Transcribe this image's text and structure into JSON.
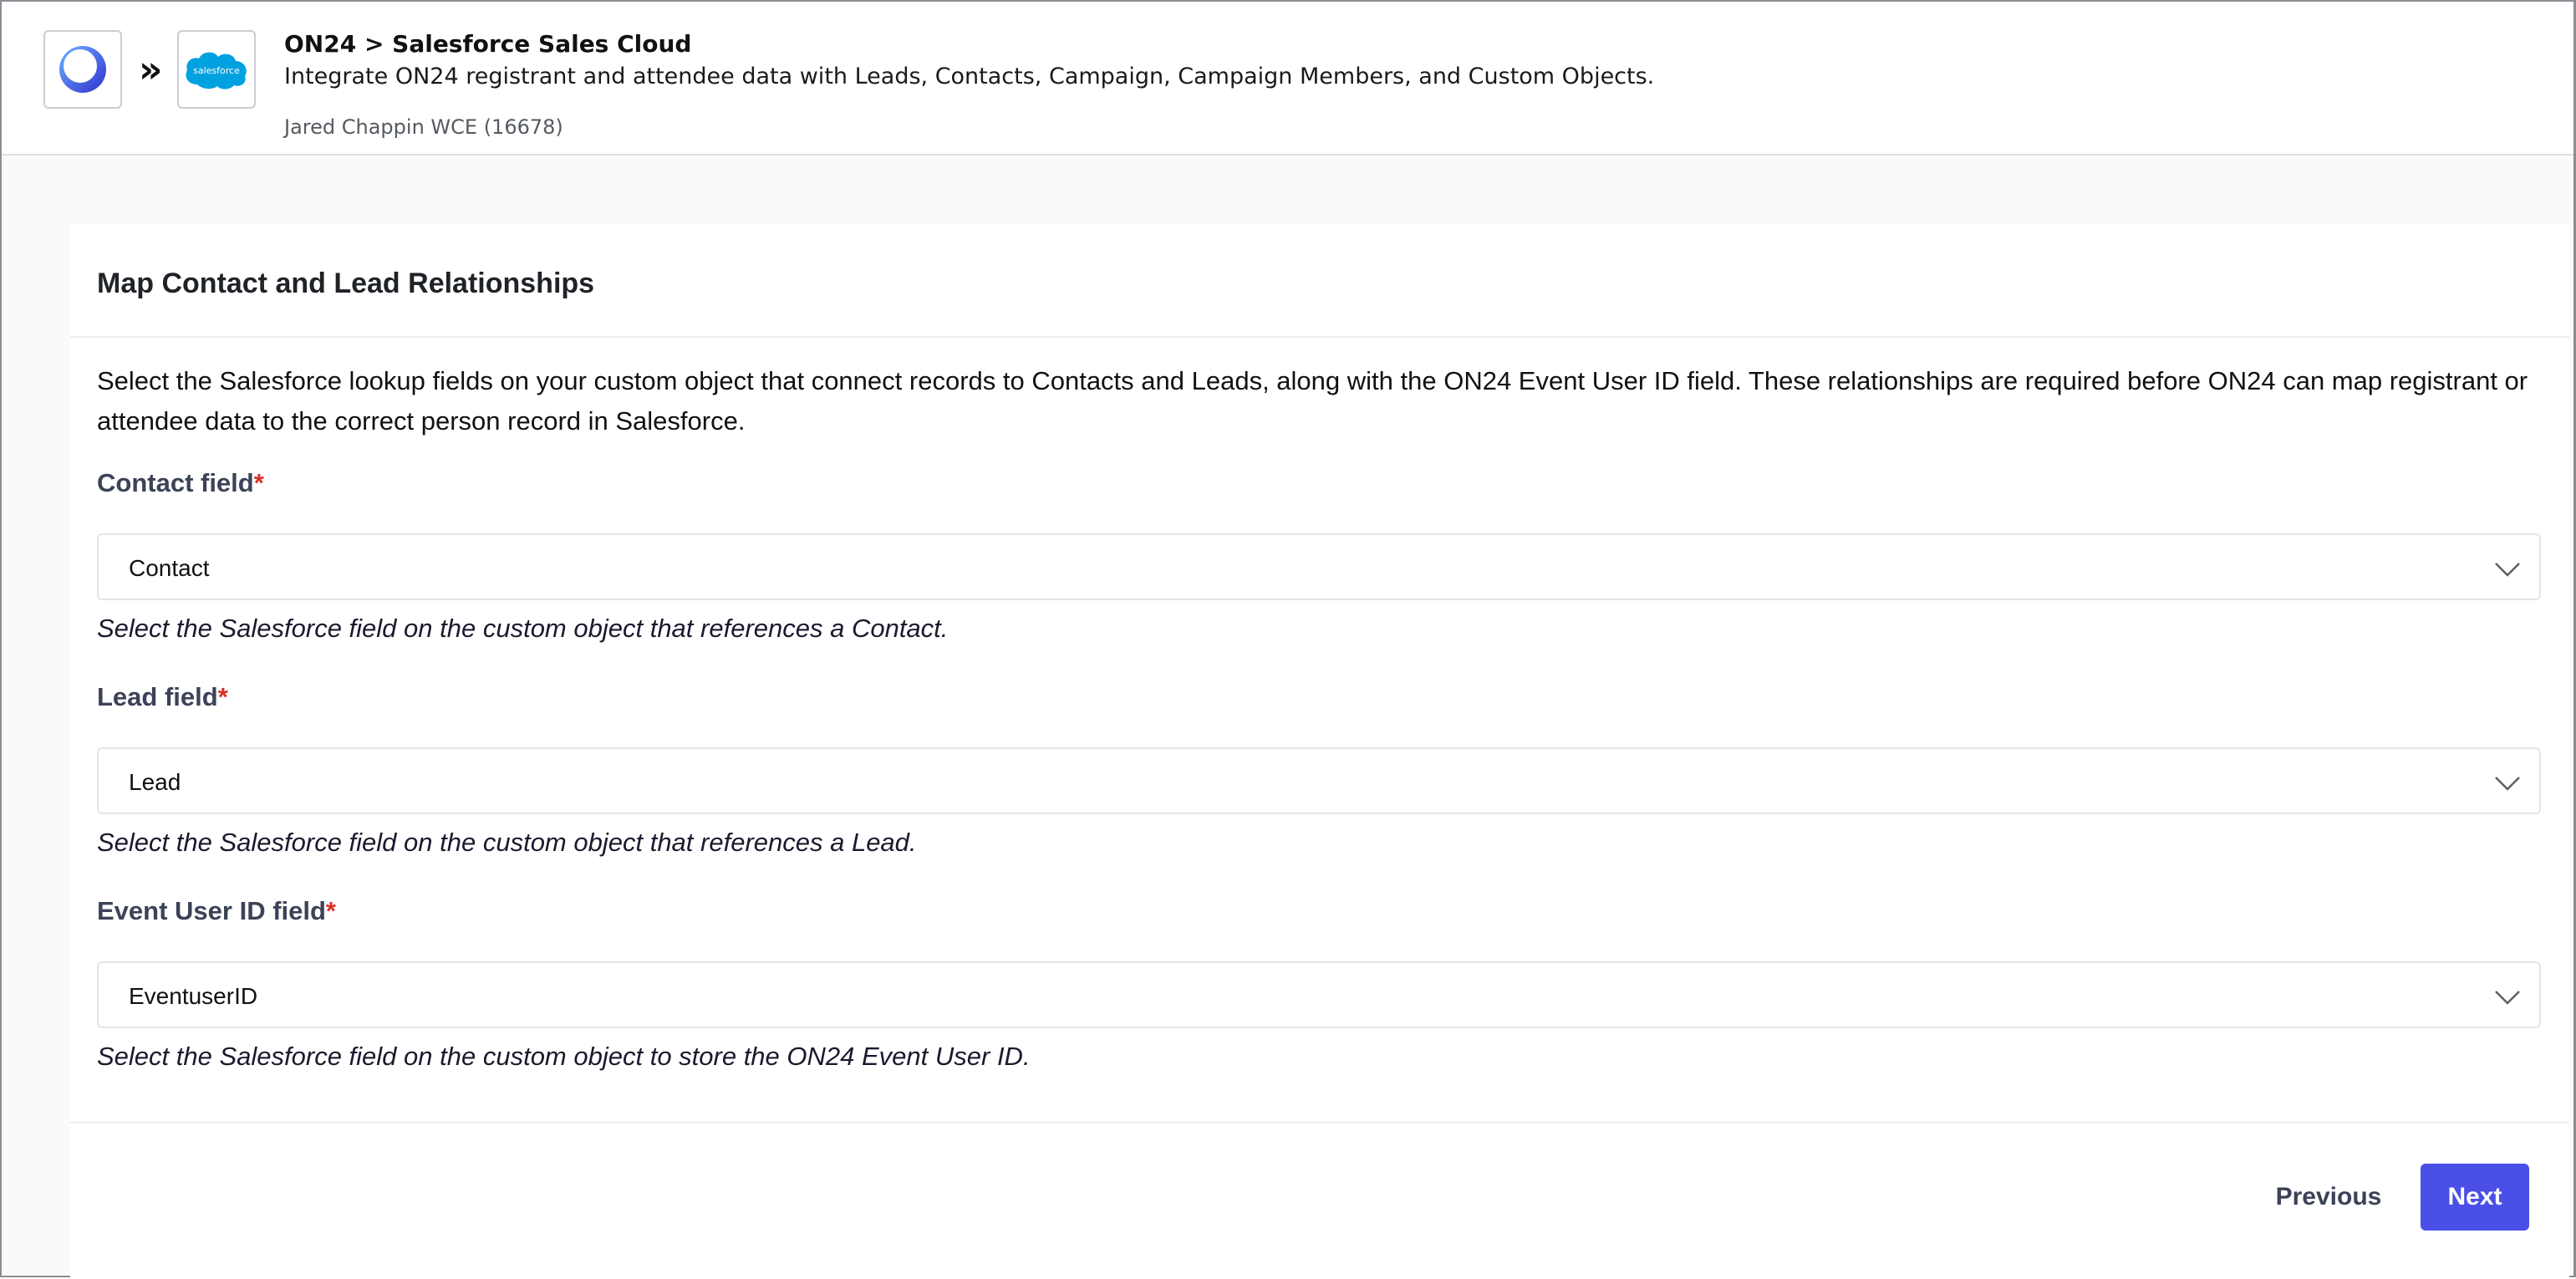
{
  "header": {
    "title": "ON24 > Salesforce Sales Cloud",
    "description": "Integrate ON24 registrant and attendee data with Leads, Contacts, Campaign, Campaign Members, and Custom Objects.",
    "account": "Jared Chappin WCE (16678)",
    "separator": "»",
    "source_logo_icon": "on24-logo-icon",
    "target_logo_text": "salesforce"
  },
  "colors": {
    "primary_button": "#4a4fe7",
    "required_asterisk": "#d93025",
    "salesforce_blue": "#00a1e0",
    "on24_blue": "#3b3fd8"
  },
  "card": {
    "title": "Map Contact and Lead Relationships",
    "intro": "Select the Salesforce lookup fields on your custom object that connect records to Contacts and Leads, along with the ON24 Event User ID field. These relationships are required before ON24 can map registrant or attendee data to the correct person record in Salesforce.",
    "fields": [
      {
        "label": "Contact field",
        "required_mark": "*",
        "value": "Contact",
        "help": "Select the Salesforce field on the custom object that references a Contact."
      },
      {
        "label": "Lead field",
        "required_mark": "*",
        "value": "Lead",
        "help": "Select the Salesforce field on the custom object that references a Lead."
      },
      {
        "label": "Event User ID field",
        "required_mark": "*",
        "value": "EventuserID",
        "help": "Select the Salesforce field on the custom object to store the ON24 Event User ID."
      }
    ]
  },
  "footer": {
    "previous_label": "Previous",
    "next_label": "Next"
  }
}
